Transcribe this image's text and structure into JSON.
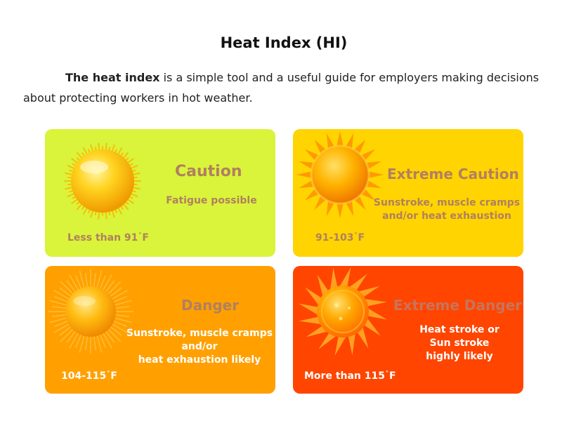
{
  "title": "Heat  Index (HI)",
  "intro": {
    "bold": "The heat index",
    "text": " is a simple tool  and a useful guide for employers making decisions about protecting workers in hot weather."
  },
  "cards": [
    {
      "level": "Caution",
      "effect": [
        "Fatigue possible"
      ],
      "range_prefix": "Less than 91",
      "degree_mark": "°",
      "range_suffix": "F",
      "background": "#d9f43a",
      "text_color": "#b08060",
      "range_color": "#b08060",
      "icon": "sun-icon"
    },
    {
      "level": "Extreme Caution",
      "effect": [
        "Sunstroke, muscle cramps",
        "and/or heat exhaustion"
      ],
      "range_prefix": "91-103",
      "degree_mark": "°",
      "range_suffix": "F",
      "background": "#ffd400",
      "text_color": "#b08060",
      "range_color": "#b08060",
      "icon": "sun-icon"
    },
    {
      "level": "Danger",
      "effect": [
        "Sunstroke, muscle cramps",
        "and/or",
        "heat exhaustion likely"
      ],
      "range_prefix": "104-115",
      "degree_mark": "°",
      "range_suffix": "F",
      "background": "#ffa000",
      "text_color": "#b08060",
      "effect_color": "#ffffff",
      "range_color": "#ffffff",
      "icon": "sun-icon"
    },
    {
      "level": "Extreme Danger",
      "effect": [
        "Heat stroke or",
        "Sun stroke",
        "highly likely"
      ],
      "range_prefix": "More than 115",
      "degree_mark": "°",
      "range_suffix": "F",
      "background": "#ff4500",
      "text_color": "#c8745a",
      "effect_color": "#ffffff",
      "range_color": "#ffffff",
      "icon": "sun-icon"
    }
  ]
}
